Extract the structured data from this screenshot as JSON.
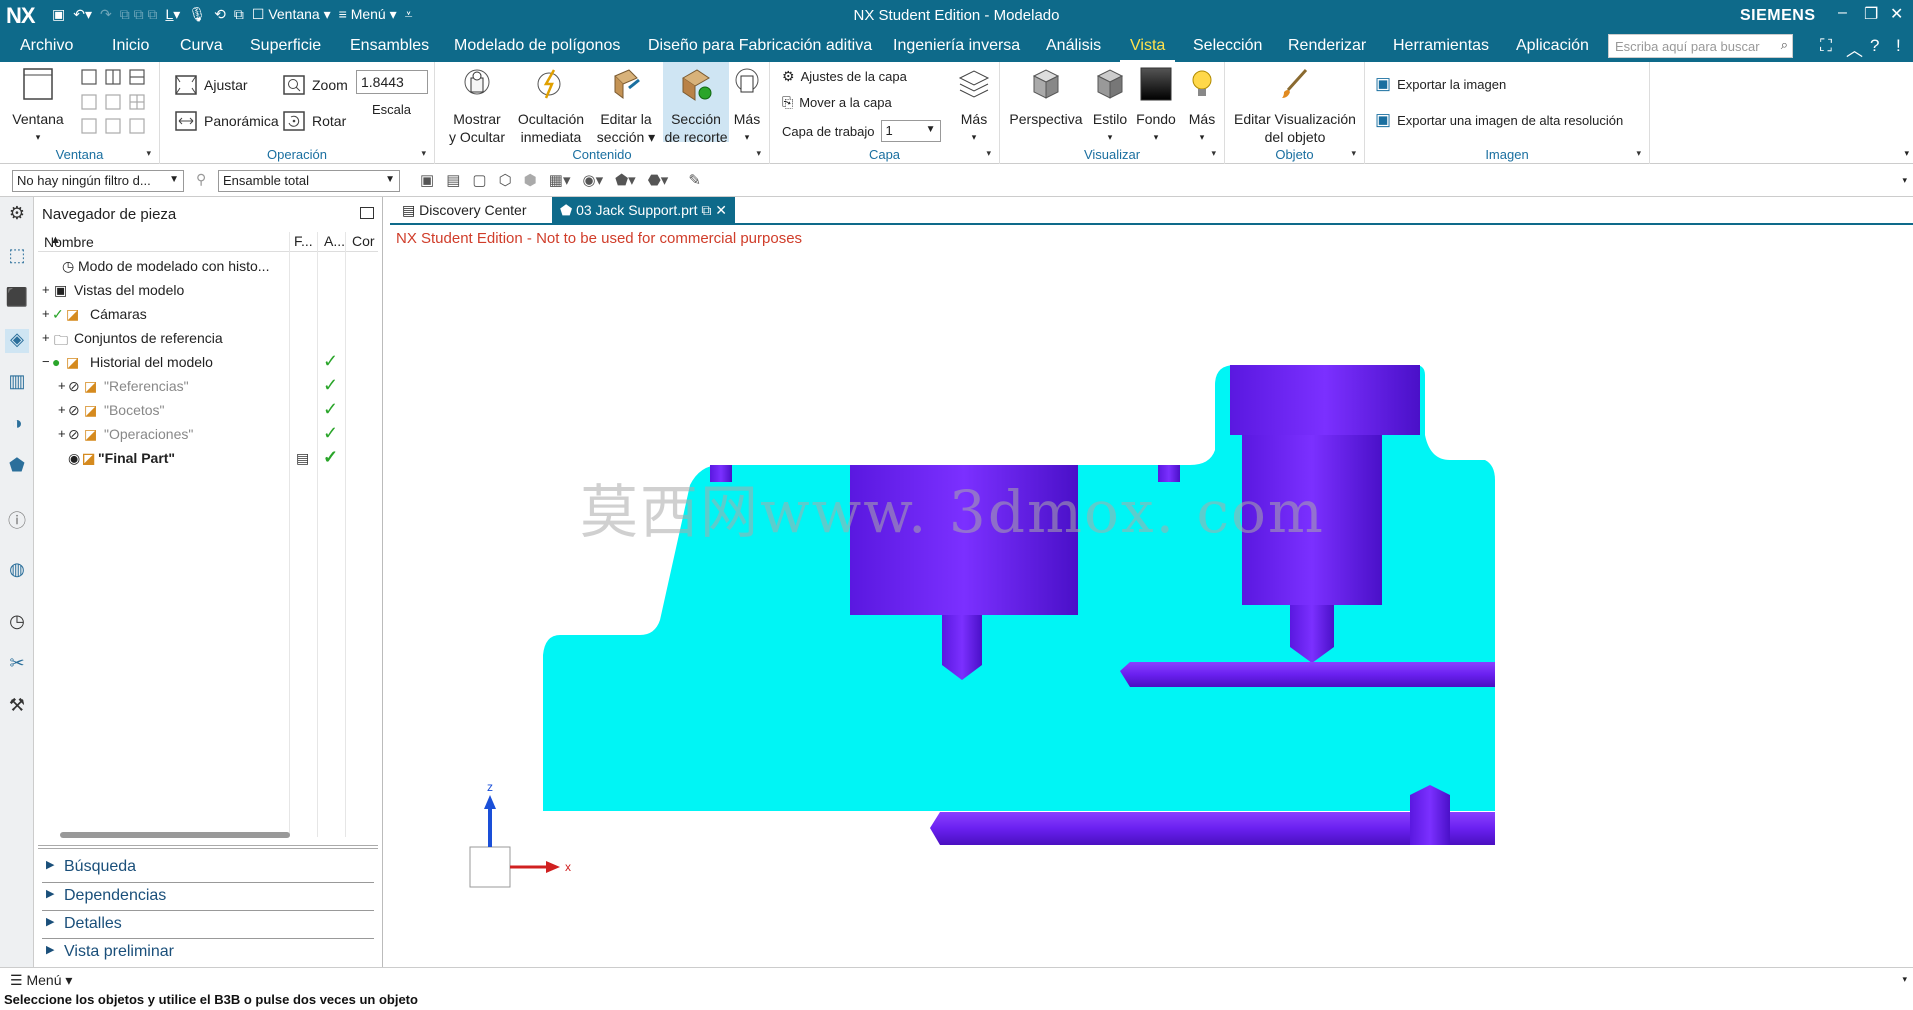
{
  "titlebar": {
    "logo": "NX",
    "title": "NX Student Edition - Modelado",
    "brand": "SIEMENS",
    "window_menu": "Ventana",
    "menu_label": "Menú"
  },
  "menubar": {
    "tabs": [
      "Archivo",
      "Inicio",
      "Curva",
      "Superficie",
      "Ensambles",
      "Modelado de polígonos",
      "Diseño para Fabricación aditiva",
      "Ingeniería inversa",
      "Análisis",
      "Vista",
      "Selección",
      "Renderizar",
      "Herramientas",
      "Aplicación"
    ],
    "active_tab": "Vista",
    "search_placeholder": "Escriba aquí para buscar"
  },
  "ribbon": {
    "ventana": {
      "button": "Ventana",
      "label": "Ventana"
    },
    "operacion": {
      "label": "Operación",
      "ajustar": "Ajustar",
      "zoom": "Zoom",
      "zoom_value": "1.8443",
      "escala": "Escala",
      "panoramica": "Panorámica",
      "rotar": "Rotar"
    },
    "contenido": {
      "label": "Contenido",
      "mostrar": [
        "Mostrar",
        "y Ocultar"
      ],
      "ocultacion": [
        "Ocultación",
        "inmediata"
      ],
      "editar": [
        "Editar la",
        "sección"
      ],
      "seccion": [
        "Sección",
        "de recorte"
      ],
      "mas": "Más"
    },
    "capa": {
      "label": "Capa",
      "ajustes": "Ajustes de la capa",
      "mover": "Mover a la capa",
      "capa_trabajo": "Capa de trabajo",
      "capa_value": "1",
      "mas": "Más"
    },
    "visualizar": {
      "label": "Visualizar",
      "perspectiva": "Perspectiva",
      "estilo": "Estilo",
      "fondo": "Fondo",
      "mas": "Más"
    },
    "objeto": {
      "label": "Objeto",
      "editar": [
        "Editar Visualización",
        "del objeto"
      ]
    },
    "imagen": {
      "label": "Imagen",
      "exportar": "Exportar la imagen",
      "exportar_alta": "Exportar una imagen de alta resolución"
    }
  },
  "selbar": {
    "filter": "No hay ningún filtro d...",
    "scope": "Ensamble total"
  },
  "navigator": {
    "title": "Navegador de pieza",
    "columns": [
      "Nombre",
      "F...",
      "A...",
      "Cor"
    ],
    "rows": [
      {
        "text": "Modo de modelado con histo...",
        "check": false,
        "dim": false,
        "bold": false
      },
      {
        "text": "Vistas del modelo",
        "check": false,
        "dim": false,
        "bold": false
      },
      {
        "text": "Cámaras",
        "check": false,
        "dim": false,
        "bold": false
      },
      {
        "text": "Conjuntos de referencia",
        "check": false,
        "dim": false,
        "bold": false
      },
      {
        "text": "Historial del modelo",
        "check": true,
        "dim": false,
        "bold": false
      },
      {
        "text": "\"Referencias\"",
        "check": true,
        "dim": true,
        "bold": false
      },
      {
        "text": "\"Bocetos\"",
        "check": true,
        "dim": true,
        "bold": false
      },
      {
        "text": "\"Operaciones\"",
        "check": true,
        "dim": true,
        "bold": false
      },
      {
        "text": "\"Final Part\"",
        "check": true,
        "dim": false,
        "bold": true
      }
    ],
    "sections": [
      "Búsqueda",
      "Dependencias",
      "Detalles",
      "Vista preliminar"
    ]
  },
  "tabs": [
    {
      "label": "Discovery Center",
      "active": false
    },
    {
      "label": "03 Jack Support.prt",
      "active": true
    }
  ],
  "viewport": {
    "warning": "NX Student Edition - Not to be used for commercial purposes",
    "watermark": "莫西网www. 3dmox. com",
    "axis_z": "z",
    "axis_x": "x",
    "colors": {
      "part": "#00f5f5",
      "holes": "#6a1ff0",
      "axis_z": "#1a4fd8",
      "axis_x": "#d02020"
    }
  },
  "statusbar": {
    "menu": "Menú",
    "cue": "Seleccione los objetos y utilice el B3B o pulse dos veces un objeto"
  }
}
